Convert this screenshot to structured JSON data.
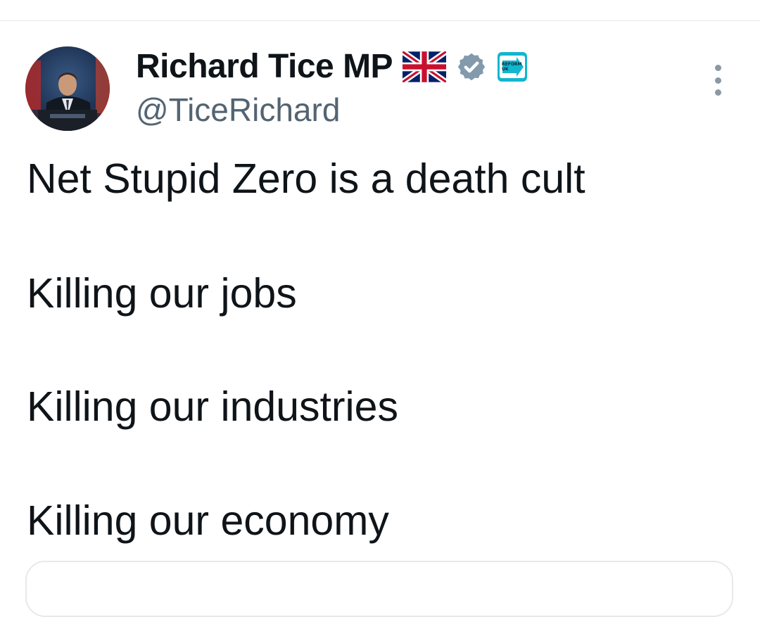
{
  "tweet": {
    "author": {
      "display_name": "Richard Tice MP",
      "handle": "@TiceRichard",
      "badges": [
        "uk-flag-icon",
        "verified-badge-icon",
        "reform-uk-logo-icon"
      ],
      "badge_logo_text": "REFORM UK"
    },
    "text_lines": [
      "Net Stupid Zero is a death cult",
      "Killing our jobs",
      "Killing our industries",
      "Killing our economy"
    ]
  },
  "colors": {
    "text_primary": "#0f1419",
    "text_secondary": "#536471",
    "verified_badge": "#829aab",
    "reform_brand": "#12b6cf",
    "divider": "#e6e9ec"
  }
}
